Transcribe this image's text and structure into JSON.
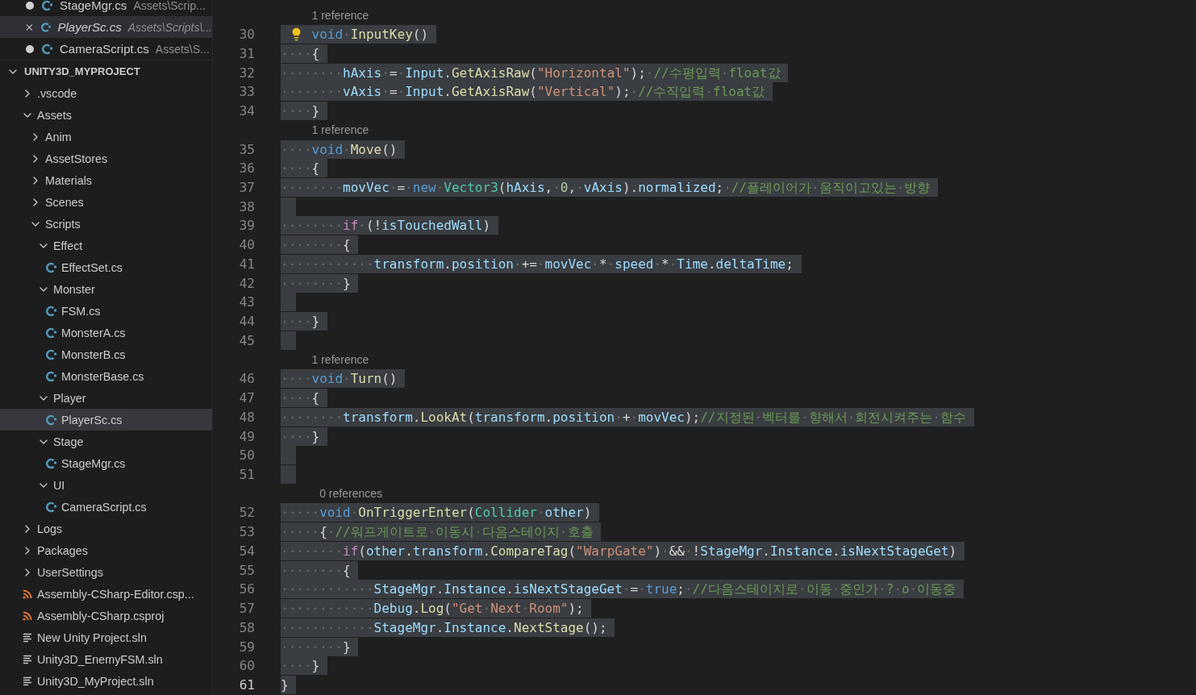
{
  "open_editors": [
    {
      "name": "StageMgr.cs",
      "path": "Assets\\Scrip...",
      "selected": false,
      "modified": true,
      "preview": false
    },
    {
      "name": "PlayerSc.cs",
      "path": "Assets\\Scripts\\...",
      "selected": true,
      "modified": false,
      "preview": true
    },
    {
      "name": "CameraScript.cs",
      "path": "Assets\\S...",
      "selected": false,
      "modified": true,
      "preview": false
    }
  ],
  "explorer": {
    "title": "UNITY3D_MYPROJECT",
    "expanded": true,
    "items": [
      {
        "label": ".vscode",
        "kind": "folder",
        "expanded": false,
        "selected": false
      },
      {
        "label": "Assets",
        "kind": "folder",
        "expanded": true,
        "selected": false,
        "children": [
          {
            "label": "Anim",
            "kind": "folder",
            "expanded": false,
            "selected": false
          },
          {
            "label": "AssetStores",
            "kind": "folder",
            "expanded": false,
            "selected": false
          },
          {
            "label": "Materials",
            "kind": "folder",
            "expanded": false,
            "selected": false
          },
          {
            "label": "Scenes",
            "kind": "folder",
            "expanded": false,
            "selected": false
          },
          {
            "label": "Scripts",
            "kind": "folder",
            "expanded": true,
            "selected": false,
            "children": [
              {
                "label": "Effect",
                "kind": "folder",
                "expanded": true,
                "selected": false,
                "children": [
                  {
                    "label": "EffectSet.cs",
                    "kind": "csharp",
                    "selected": false
                  }
                ]
              },
              {
                "label": "Monster",
                "kind": "folder",
                "expanded": true,
                "selected": false,
                "children": [
                  {
                    "label": "FSM.cs",
                    "kind": "csharp",
                    "selected": false
                  },
                  {
                    "label": "MonsterA.cs",
                    "kind": "csharp",
                    "selected": false
                  },
                  {
                    "label": "MonsterB.cs",
                    "kind": "csharp",
                    "selected": false
                  },
                  {
                    "label": "MonsterBase.cs",
                    "kind": "csharp",
                    "selected": false
                  }
                ]
              },
              {
                "label": "Player",
                "kind": "folder",
                "expanded": true,
                "selected": false,
                "children": [
                  {
                    "label": "PlayerSc.cs",
                    "kind": "csharp",
                    "selected": true
                  }
                ]
              },
              {
                "label": "Stage",
                "kind": "folder",
                "expanded": true,
                "selected": false,
                "children": [
                  {
                    "label": "StageMgr.cs",
                    "kind": "csharp",
                    "selected": false
                  }
                ]
              },
              {
                "label": "UI",
                "kind": "folder",
                "expanded": true,
                "selected": false,
                "children": [
                  {
                    "label": "CameraScript.cs",
                    "kind": "csharp",
                    "selected": false
                  }
                ]
              }
            ]
          }
        ]
      },
      {
        "label": "Logs",
        "kind": "folder",
        "expanded": false,
        "selected": false
      },
      {
        "label": "Packages",
        "kind": "folder",
        "expanded": false,
        "selected": false
      },
      {
        "label": "UserSettings",
        "kind": "folder",
        "expanded": false,
        "selected": false
      },
      {
        "label": "Assembly-CSharp-Editor.csp...",
        "kind": "csproj",
        "selected": false
      },
      {
        "label": "Assembly-CSharp.csproj",
        "kind": "csproj",
        "selected": false
      },
      {
        "label": "New Unity Project.sln",
        "kind": "sln",
        "selected": false
      },
      {
        "label": "Unity3D_EnemyFSM.sln",
        "kind": "sln",
        "selected": false
      },
      {
        "label": "Unity3D_MyProject.sln",
        "kind": "sln",
        "selected": false
      }
    ]
  },
  "editor": {
    "selected": true,
    "lines": [
      {
        "number": "30",
        "current": false,
        "lightbulb": true,
        "codelens": "1 reference",
        "tokens": [
          {
            "kind": "kw",
            "text": "void"
          },
          {
            "kind": "ws",
            "text": "·"
          },
          {
            "kind": "fn",
            "text": "InputKey"
          },
          {
            "kind": "plain",
            "text": "()"
          }
        ]
      },
      {
        "number": "31",
        "current": false,
        "tokens": [
          {
            "kind": "ws",
            "text": "····"
          },
          {
            "kind": "plain",
            "text": "{"
          }
        ]
      },
      {
        "number": "32",
        "current": false,
        "tokens": [
          {
            "kind": "ws",
            "text": "········"
          },
          {
            "kind": "var",
            "text": "hAxis"
          },
          {
            "kind": "plain",
            "text": "·=·"
          },
          {
            "kind": "var",
            "text": "Input"
          },
          {
            "kind": "plain",
            "text": "."
          },
          {
            "kind": "fn",
            "text": "GetAxisRaw"
          },
          {
            "kind": "plain",
            "text": "("
          },
          {
            "kind": "str",
            "text": "\"Horizontal\""
          },
          {
            "kind": "plain",
            "text": ");·"
          },
          {
            "kind": "comment",
            "text": "//수평입력·float값"
          }
        ]
      },
      {
        "number": "33",
        "current": false,
        "tokens": [
          {
            "kind": "ws",
            "text": "········"
          },
          {
            "kind": "var",
            "text": "vAxis"
          },
          {
            "kind": "plain",
            "text": "·=·"
          },
          {
            "kind": "var",
            "text": "Input"
          },
          {
            "kind": "plain",
            "text": "."
          },
          {
            "kind": "fn",
            "text": "GetAxisRaw"
          },
          {
            "kind": "plain",
            "text": "("
          },
          {
            "kind": "str",
            "text": "\"Vertical\""
          },
          {
            "kind": "plain",
            "text": ");·"
          },
          {
            "kind": "comment",
            "text": "//수직입력·float값"
          }
        ]
      },
      {
        "number": "34",
        "current": false,
        "tokens": [
          {
            "kind": "ws",
            "text": "····"
          },
          {
            "kind": "plain",
            "text": "}"
          }
        ]
      },
      {
        "number": "35",
        "current": false,
        "codelens": "1 reference",
        "tokens": [
          {
            "kind": "ws",
            "text": "····"
          },
          {
            "kind": "kw",
            "text": "void"
          },
          {
            "kind": "ws",
            "text": "·"
          },
          {
            "kind": "fn",
            "text": "Move"
          },
          {
            "kind": "plain",
            "text": "()"
          }
        ]
      },
      {
        "number": "36",
        "current": false,
        "tokens": [
          {
            "kind": "ws",
            "text": "····"
          },
          {
            "kind": "plain",
            "text": "{"
          }
        ]
      },
      {
        "number": "37",
        "current": false,
        "tokens": [
          {
            "kind": "ws",
            "text": "········"
          },
          {
            "kind": "var",
            "text": "movVec"
          },
          {
            "kind": "plain",
            "text": "·=·"
          },
          {
            "kind": "kw",
            "text": "new"
          },
          {
            "kind": "ws",
            "text": "·"
          },
          {
            "kind": "type",
            "text": "Vector3"
          },
          {
            "kind": "plain",
            "text": "("
          },
          {
            "kind": "var",
            "text": "hAxis"
          },
          {
            "kind": "plain",
            "text": ",·"
          },
          {
            "kind": "num",
            "text": "0"
          },
          {
            "kind": "plain",
            "text": ",·"
          },
          {
            "kind": "var",
            "text": "vAxis"
          },
          {
            "kind": "plain",
            "text": ")."
          },
          {
            "kind": "var",
            "text": "normalized"
          },
          {
            "kind": "plain",
            "text": ";·"
          },
          {
            "kind": "comment",
            "text": "//플레이어가·움직이고있는·방향"
          }
        ]
      },
      {
        "number": "38",
        "current": false
      },
      {
        "number": "39",
        "current": false,
        "tokens": [
          {
            "kind": "ws",
            "text": "········"
          },
          {
            "kind": "ctrl",
            "text": "if"
          },
          {
            "kind": "plain",
            "text": "·(!"
          },
          {
            "kind": "var",
            "text": "isTouchedWall"
          },
          {
            "kind": "plain",
            "text": ")"
          }
        ]
      },
      {
        "number": "40",
        "current": false,
        "tokens": [
          {
            "kind": "ws",
            "text": "········"
          },
          {
            "kind": "plain",
            "text": "{"
          }
        ]
      },
      {
        "number": "41",
        "current": false,
        "tokens": [
          {
            "kind": "ws",
            "text": "············"
          },
          {
            "kind": "var",
            "text": "transform"
          },
          {
            "kind": "plain",
            "text": "."
          },
          {
            "kind": "var",
            "text": "position"
          },
          {
            "kind": "plain",
            "text": "·+=·"
          },
          {
            "kind": "var",
            "text": "movVec"
          },
          {
            "kind": "plain",
            "text": "·*·"
          },
          {
            "kind": "var",
            "text": "speed"
          },
          {
            "kind": "plain",
            "text": "·*·"
          },
          {
            "kind": "var",
            "text": "Time"
          },
          {
            "kind": "plain",
            "text": "."
          },
          {
            "kind": "var",
            "text": "deltaTime"
          },
          {
            "kind": "plain",
            "text": ";"
          }
        ]
      },
      {
        "number": "42",
        "current": false,
        "tokens": [
          {
            "kind": "ws",
            "text": "········"
          },
          {
            "kind": "plain",
            "text": "}"
          }
        ]
      },
      {
        "number": "43",
        "current": false
      },
      {
        "number": "44",
        "current": false,
        "tokens": [
          {
            "kind": "ws",
            "text": "····"
          },
          {
            "kind": "plain",
            "text": "}"
          }
        ]
      },
      {
        "number": "45",
        "current": false
      },
      {
        "number": "46",
        "current": false,
        "codelens": "1 reference",
        "tokens": [
          {
            "kind": "ws",
            "text": "····"
          },
          {
            "kind": "kw",
            "text": "void"
          },
          {
            "kind": "ws",
            "text": "·"
          },
          {
            "kind": "fn",
            "text": "Turn"
          },
          {
            "kind": "plain",
            "text": "()"
          }
        ]
      },
      {
        "number": "47",
        "current": false,
        "tokens": [
          {
            "kind": "ws",
            "text": "····"
          },
          {
            "kind": "plain",
            "text": "{"
          }
        ]
      },
      {
        "number": "48",
        "current": false,
        "tokens": [
          {
            "kind": "ws",
            "text": "········"
          },
          {
            "kind": "var",
            "text": "transform"
          },
          {
            "kind": "plain",
            "text": "."
          },
          {
            "kind": "fn",
            "text": "LookAt"
          },
          {
            "kind": "plain",
            "text": "("
          },
          {
            "kind": "var",
            "text": "transform"
          },
          {
            "kind": "plain",
            "text": "."
          },
          {
            "kind": "var",
            "text": "position"
          },
          {
            "kind": "plain",
            "text": "·+·"
          },
          {
            "kind": "var",
            "text": "movVec"
          },
          {
            "kind": "plain",
            "text": ");"
          },
          {
            "kind": "comment",
            "text": "//지정된·벡터를·향해서·회전시켜주는·함수"
          }
        ]
      },
      {
        "number": "49",
        "current": false,
        "tokens": [
          {
            "kind": "ws",
            "text": "····"
          },
          {
            "kind": "plain",
            "text": "}"
          }
        ]
      },
      {
        "number": "50",
        "current": false
      },
      {
        "number": "51",
        "current": false
      },
      {
        "number": "52",
        "current": false,
        "codelens": "0 references",
        "tokens": [
          {
            "kind": "ws",
            "text": "·····"
          },
          {
            "kind": "kw",
            "text": "void"
          },
          {
            "kind": "ws",
            "text": "·"
          },
          {
            "kind": "fn",
            "text": "OnTriggerEnter"
          },
          {
            "kind": "plain",
            "text": "("
          },
          {
            "kind": "type",
            "text": "Collider"
          },
          {
            "kind": "ws",
            "text": "·"
          },
          {
            "kind": "var",
            "text": "other"
          },
          {
            "kind": "plain",
            "text": ")"
          }
        ]
      },
      {
        "number": "53",
        "current": false,
        "tokens": [
          {
            "kind": "ws",
            "text": "·····"
          },
          {
            "kind": "plain",
            "text": "{·"
          },
          {
            "kind": "comment",
            "text": "//워프게이트로·이동시·다음스테이지·호출"
          }
        ]
      },
      {
        "number": "54",
        "current": false,
        "tokens": [
          {
            "kind": "ws",
            "text": "········"
          },
          {
            "kind": "ctrl",
            "text": "if"
          },
          {
            "kind": "plain",
            "text": "("
          },
          {
            "kind": "var",
            "text": "other"
          },
          {
            "kind": "plain",
            "text": "."
          },
          {
            "kind": "var",
            "text": "transform"
          },
          {
            "kind": "plain",
            "text": "."
          },
          {
            "kind": "fn",
            "text": "CompareTag"
          },
          {
            "kind": "plain",
            "text": "("
          },
          {
            "kind": "str",
            "text": "\"WarpGate\""
          },
          {
            "kind": "plain",
            "text": ")·&&·!"
          },
          {
            "kind": "var",
            "text": "StageMgr"
          },
          {
            "kind": "plain",
            "text": "."
          },
          {
            "kind": "var",
            "text": "Instance"
          },
          {
            "kind": "plain",
            "text": "."
          },
          {
            "kind": "var",
            "text": "isNextStageGet"
          },
          {
            "kind": "plain",
            "text": ")"
          }
        ]
      },
      {
        "number": "55",
        "current": false,
        "tokens": [
          {
            "kind": "ws",
            "text": "········"
          },
          {
            "kind": "plain",
            "text": "{"
          }
        ]
      },
      {
        "number": "56",
        "current": false,
        "tokens": [
          {
            "kind": "ws",
            "text": "············"
          },
          {
            "kind": "var",
            "text": "StageMgr"
          },
          {
            "kind": "plain",
            "text": "."
          },
          {
            "kind": "var",
            "text": "Instance"
          },
          {
            "kind": "plain",
            "text": "."
          },
          {
            "kind": "var",
            "text": "isNextStageGet"
          },
          {
            "kind": "plain",
            "text": "·=·"
          },
          {
            "kind": "kw",
            "text": "true"
          },
          {
            "kind": "plain",
            "text": ";·"
          },
          {
            "kind": "comment",
            "text": "//다음스테이지로·이동·중인가·?·o·이동중"
          }
        ]
      },
      {
        "number": "57",
        "current": false,
        "tokens": [
          {
            "kind": "ws",
            "text": "············"
          },
          {
            "kind": "var",
            "text": "Debug"
          },
          {
            "kind": "plain",
            "text": "."
          },
          {
            "kind": "fn",
            "text": "Log"
          },
          {
            "kind": "plain",
            "text": "("
          },
          {
            "kind": "str",
            "text": "\"Get·Next·Room\""
          },
          {
            "kind": "plain",
            "text": ");"
          }
        ]
      },
      {
        "number": "58",
        "current": false,
        "tokens": [
          {
            "kind": "ws",
            "text": "············"
          },
          {
            "kind": "var",
            "text": "StageMgr"
          },
          {
            "kind": "plain",
            "text": "."
          },
          {
            "kind": "var",
            "text": "Instance"
          },
          {
            "kind": "plain",
            "text": "."
          },
          {
            "kind": "fn",
            "text": "NextStage"
          },
          {
            "kind": "plain",
            "text": "();"
          }
        ]
      },
      {
        "number": "59",
        "current": false,
        "tokens": [
          {
            "kind": "ws",
            "text": "········"
          },
          {
            "kind": "plain",
            "text": "}"
          }
        ]
      },
      {
        "number": "60",
        "current": false,
        "tokens": [
          {
            "kind": "ws",
            "text": "····"
          },
          {
            "kind": "plain",
            "text": "}"
          }
        ]
      },
      {
        "number": "61",
        "current": true,
        "tokens": [
          {
            "kind": "plain",
            "text": "}"
          }
        ]
      }
    ]
  }
}
